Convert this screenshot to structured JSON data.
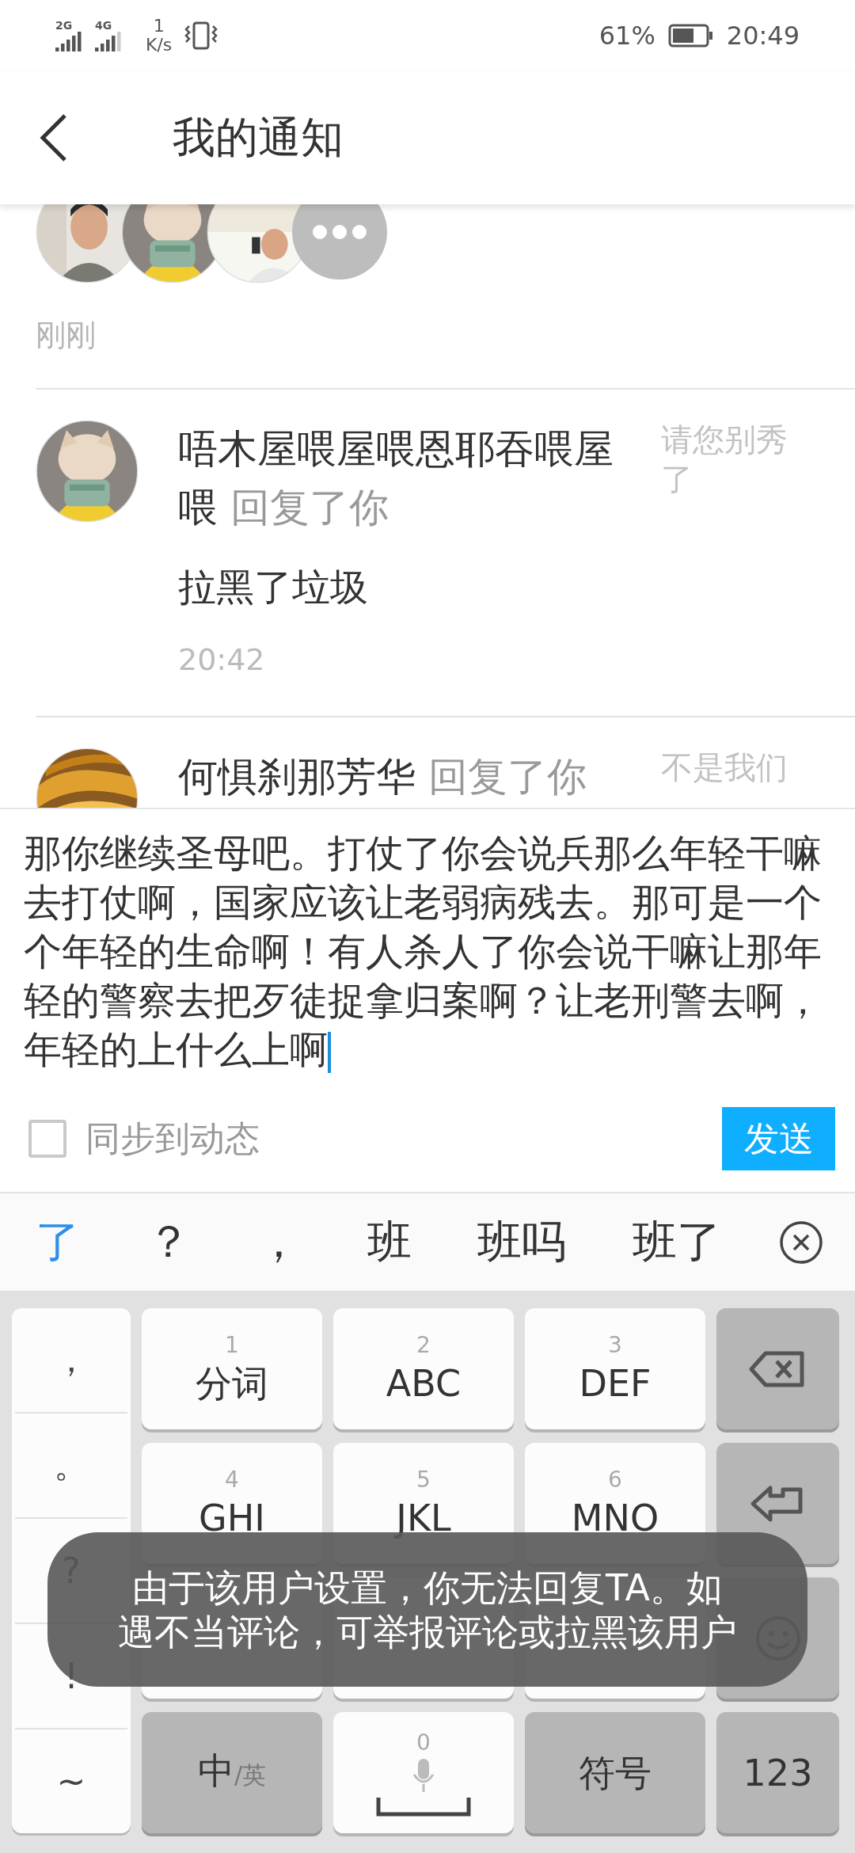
{
  "status_bar": {
    "network_1": "2G",
    "network_2": "4G",
    "speed_value": "1",
    "speed_unit": "K/s",
    "battery": "61%",
    "time": "20:49"
  },
  "header": {
    "title": "我的通知"
  },
  "notifications": [
    {
      "kind": "avatars",
      "time": "刚刚"
    },
    {
      "kind": "reply",
      "user": "唔木屋喂屋喂恩耶吞喂屋喂",
      "action": "回复了你",
      "content": "拉黑了垃圾",
      "time": "20:42",
      "quote": "请您别秀了"
    },
    {
      "kind": "reply",
      "user": "何惧刹那芳华",
      "action": "回复了你",
      "quote": "不是我们"
    }
  ],
  "compose": {
    "value": "那你继续圣母吧。打仗了你会说兵那么年轻干嘛去打仗啊，国家应该让老弱病残去。那可是一个个年轻的生命啊！有人杀人了你会说干嘛让那年轻的警察去把歹徒捉拿归案啊？让老刑警去啊，年轻的上什么上啊",
    "sync": {
      "label": "同步到动态",
      "checked": false
    },
    "send": "发送"
  },
  "candidates": [
    {
      "text": "了",
      "selected": true
    },
    {
      "text": "？",
      "selected": false
    },
    {
      "text": "，",
      "selected": false
    },
    {
      "text": "班",
      "selected": false
    },
    {
      "text": "班吗",
      "selected": false
    },
    {
      "text": "班了",
      "selected": false
    }
  ],
  "keyboard": {
    "symbols": [
      "，",
      "。",
      "?",
      "!",
      "~"
    ],
    "rows": [
      [
        {
          "kind": "key",
          "digit": "1",
          "label": "分词"
        },
        {
          "kind": "key",
          "digit": "2",
          "label": "ABC"
        },
        {
          "kind": "key",
          "digit": "3",
          "label": "DEF"
        },
        {
          "kind": "backspace"
        }
      ],
      [
        {
          "kind": "key",
          "digit": "4",
          "label": "GHI"
        },
        {
          "kind": "key",
          "digit": "5",
          "label": "JKL"
        },
        {
          "kind": "key",
          "digit": "6",
          "label": "MNO"
        },
        {
          "kind": "enter"
        }
      ],
      [
        {
          "kind": "blank"
        },
        {
          "kind": "blank"
        },
        {
          "kind": "blank"
        },
        {
          "kind": "emoji"
        }
      ],
      [
        {
          "kind": "lang",
          "label": "中",
          "sub": "/英"
        },
        {
          "kind": "space",
          "digit": "0"
        },
        {
          "kind": "dark",
          "label": "符号"
        },
        {
          "kind": "dark",
          "label": "123"
        }
      ]
    ]
  },
  "toast": {
    "lines": [
      "由于该用户设置，你无法回复TA。如",
      "遇不当评论，可举报评论或拉黑该用户"
    ]
  }
}
